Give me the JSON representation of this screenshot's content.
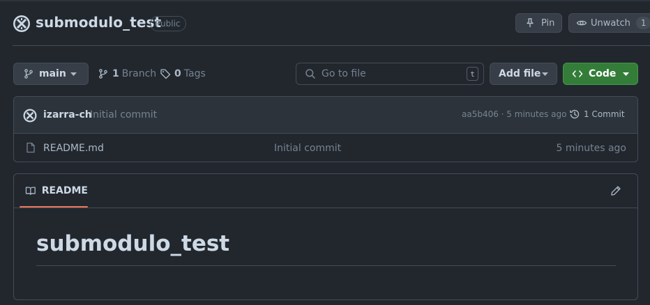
{
  "repo": {
    "name": "submodulo_test",
    "visibility": "Public",
    "pin_label": "Pin",
    "watch_label": "Unwatch",
    "watch_count": "1"
  },
  "toolbar": {
    "branch": "main",
    "branches_count": "1",
    "branches_label": "Branch",
    "tags_count": "0",
    "tags_label": "Tags",
    "goto_placeholder": "Go to file",
    "goto_shortcut": "t",
    "add_file_label": "Add file",
    "code_label": "Code"
  },
  "latest_commit": {
    "author": "izarra-ch",
    "message": "Initial commit",
    "meta": "aa5b406 · 5 minutes ago",
    "commits_label": "1 Commit"
  },
  "files": [
    {
      "name": "README.md",
      "commit": "Initial commit",
      "time": "5 minutes ago"
    }
  ],
  "readme": {
    "tab_label": "README",
    "heading": "submodulo_test"
  },
  "colors": {
    "background": "#22272e",
    "border": "#444c56",
    "code_button": "#347d39",
    "tab_accent": "#ec775c"
  },
  "icons": [
    "repo-avatar-icon",
    "pin-icon",
    "eye-icon",
    "git-branch-icon",
    "tag-icon",
    "search-icon",
    "code-icon",
    "history-icon",
    "file-icon",
    "book-icon",
    "pencil-icon",
    "caret-down-icon"
  ]
}
